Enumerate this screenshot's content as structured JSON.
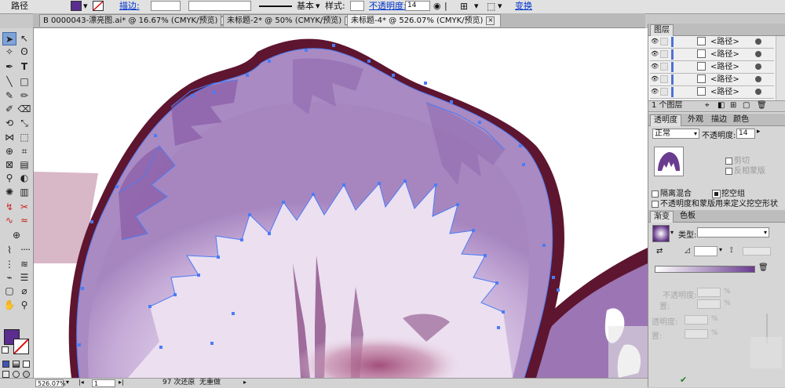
{
  "control_bar": {
    "path_label": "路径",
    "fill_color": "#5b2d8e",
    "stroke_label": "描边:",
    "stroke_value": "",
    "brush_value": "",
    "basic_label": "基本",
    "style_label": "样式:",
    "opacity_label": "不透明度:",
    "opacity_value": "14",
    "transform_label": "变换"
  },
  "tabs": [
    {
      "label": "B 0000043-漂亮图.ai* @ 16.67% (CMYK/预览)",
      "active": false
    },
    {
      "label": "未标题-2* @ 50% (CMYK/预览)",
      "active": false
    },
    {
      "label": "未标题-4* @ 526.07% (CMYK/预览)",
      "active": true
    }
  ],
  "tools": {
    "fill_color": "#5b2d8e",
    "stroke_color": "#b31a1a"
  },
  "status_bar": {
    "zoom": "526.07%",
    "page": "1",
    "undo_text": "97 次还原",
    "redo_text": "无重做"
  },
  "layers_panel": {
    "title": "图层",
    "rows": [
      "<路径>",
      "<路径>",
      "<路径>",
      "<路径>",
      "<路径>",
      "<路径>"
    ],
    "footer_label": "1 个图层"
  },
  "transparency_panel": {
    "tabs": [
      "透明度",
      "外观",
      "描边",
      "颜色"
    ],
    "blend_mode": "正常",
    "opacity_label": "不透明度:",
    "opacity_value": "14",
    "clip_label": "剪切",
    "invert_label": "反相蒙版",
    "isolate_label": "隔离混合",
    "knockout_label": "挖空组",
    "define_label": "不透明度和蒙版用来定义挖空形状"
  },
  "gradient_panel": {
    "tabs": [
      "渐变",
      "色板"
    ],
    "type_label": "类型:",
    "type_value": "",
    "opacity_label_1": "不透明度:",
    "location_label_1": "置:",
    "opacity_label_2": "透明度:",
    "location_label_2": "置:",
    "percent": "%"
  },
  "canvas": {
    "dark_edge_color": "#5e1530",
    "petal_color": "#a98ac2",
    "highlight_color": "#ece0ee",
    "path_color": "#4b7cf5"
  }
}
